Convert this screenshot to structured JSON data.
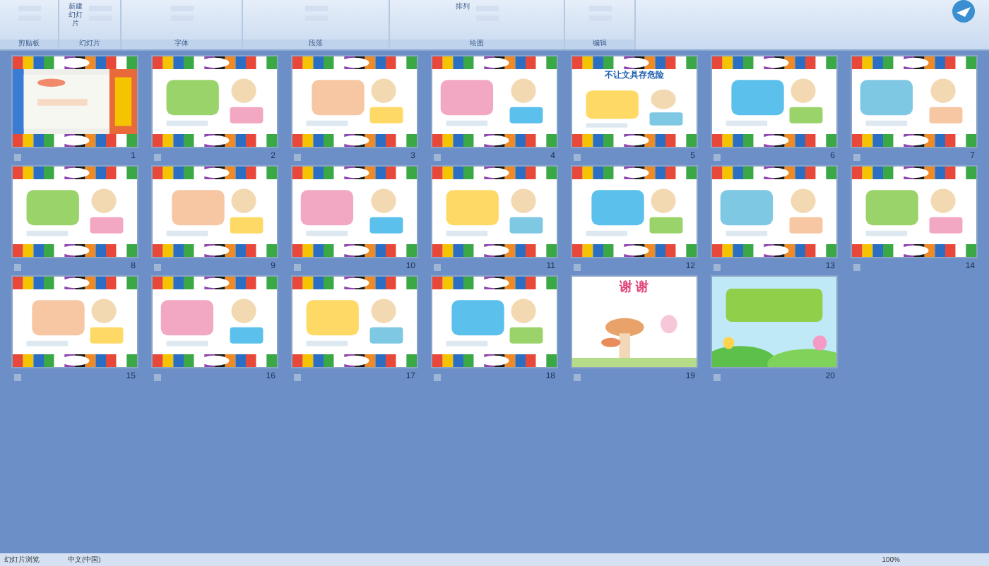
{
  "ribbon": {
    "groups": [
      {
        "label": "剪贴板",
        "kind": "clipboard"
      },
      {
        "label": "幻灯片",
        "kind": "slides",
        "button": "新建幻灯片"
      },
      {
        "label": "字体",
        "kind": "font"
      },
      {
        "label": "段落",
        "kind": "paragraph"
      },
      {
        "label": "绘图",
        "kind": "drawing",
        "button": "排列"
      },
      {
        "label": "编辑",
        "kind": "editing"
      }
    ]
  },
  "slides": [
    {
      "number": "1",
      "kind": "cover"
    },
    {
      "number": "2",
      "kind": "content"
    },
    {
      "number": "3",
      "kind": "content"
    },
    {
      "number": "4",
      "kind": "content"
    },
    {
      "number": "5",
      "kind": "content",
      "title": "不让文具存危险"
    },
    {
      "number": "6",
      "kind": "content"
    },
    {
      "number": "7",
      "kind": "content"
    },
    {
      "number": "8",
      "kind": "content"
    },
    {
      "number": "9",
      "kind": "content"
    },
    {
      "number": "10",
      "kind": "content"
    },
    {
      "number": "11",
      "kind": "content"
    },
    {
      "number": "12",
      "kind": "content"
    },
    {
      "number": "13",
      "kind": "content"
    },
    {
      "number": "14",
      "kind": "content"
    },
    {
      "number": "15",
      "kind": "content"
    },
    {
      "number": "16",
      "kind": "content"
    },
    {
      "number": "17",
      "kind": "content"
    },
    {
      "number": "18",
      "kind": "content"
    },
    {
      "number": "19",
      "kind": "thanks",
      "title": "谢 谢"
    },
    {
      "number": "20",
      "kind": "ending"
    }
  ],
  "status_bar": {
    "view": "幻灯片浏览",
    "language": "中文(中国)",
    "zoom": "100%"
  }
}
